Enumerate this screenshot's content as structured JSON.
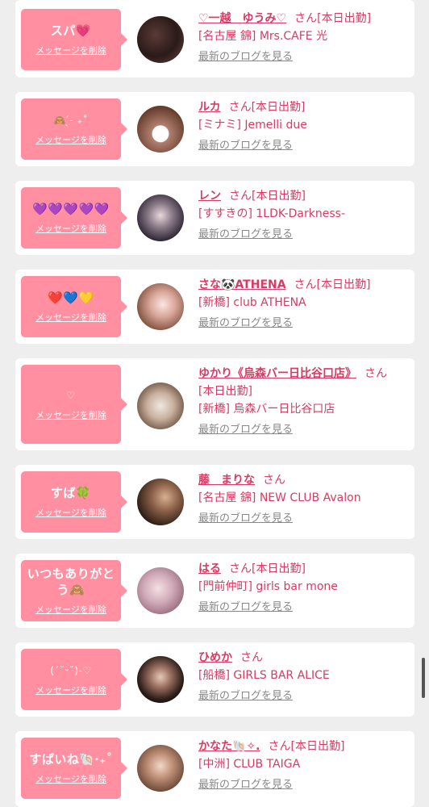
{
  "colors": {
    "bubble": "#ff8fa1",
    "name_text": "#d93a64",
    "blog_link": "#888888",
    "card_bg": "#ffffff",
    "page_bg": "#eeeeee"
  },
  "delete_label": "メッセージを削除",
  "blog_label": "最新のブログを見る",
  "cards": [
    {
      "message": "スパ💗",
      "name": "♡一越　ゆうみ♡",
      "suffix": "さん[本日出勤]",
      "status": "",
      "shop": "[名古屋 錦] Mrs.CAFE 光"
    },
    {
      "message": "🙈 ̖́-‬ ₊˚",
      "name": "ルカ",
      "suffix": "さん[本日出勤]",
      "status": "",
      "shop": "[ミナミ] Jemelli due"
    },
    {
      "message": "💜💜💜💜💜",
      "name": "レン",
      "suffix": "さん[本日出勤]",
      "status": "",
      "shop": "[すすきの] 1LDK-Darkness-"
    },
    {
      "message": "❤️💙💛",
      "name": "さな🐼ATHENA",
      "suffix": "さん[本日出勤]",
      "status": "",
      "shop": "[新橋] club ATHENA"
    },
    {
      "message": "♡",
      "name": "ゆかり《烏森バー日比谷口店》",
      "suffix": "さん",
      "status": "[本日出勤]",
      "shop": "[新橋] 烏森バー日比谷口店"
    },
    {
      "message": "すぱ🍀",
      "name": "藤　まりな",
      "suffix": "さん",
      "status": "",
      "shop": "[名古屋 錦] NEW CLUB Avalon"
    },
    {
      "message": "いつもありがとう🙈",
      "name": "はる",
      "suffix": "さん[本日出勤]",
      "status": "",
      "shop": "[門前仲町] girls bar mone"
    },
    {
      "message": "(ˊ˘ᵕ˘)-♡",
      "name": "ひめか",
      "suffix": "さん",
      "status": "",
      "shop": "[船橋] GIRLS BAR ALICE"
    },
    {
      "message": "すぱいね🐚‧₊˚",
      "name": "かなた🐚✧.",
      "suffix": "さん[本日出勤]",
      "status": "",
      "shop": "[中洲] CLUB TAIGA"
    }
  ]
}
